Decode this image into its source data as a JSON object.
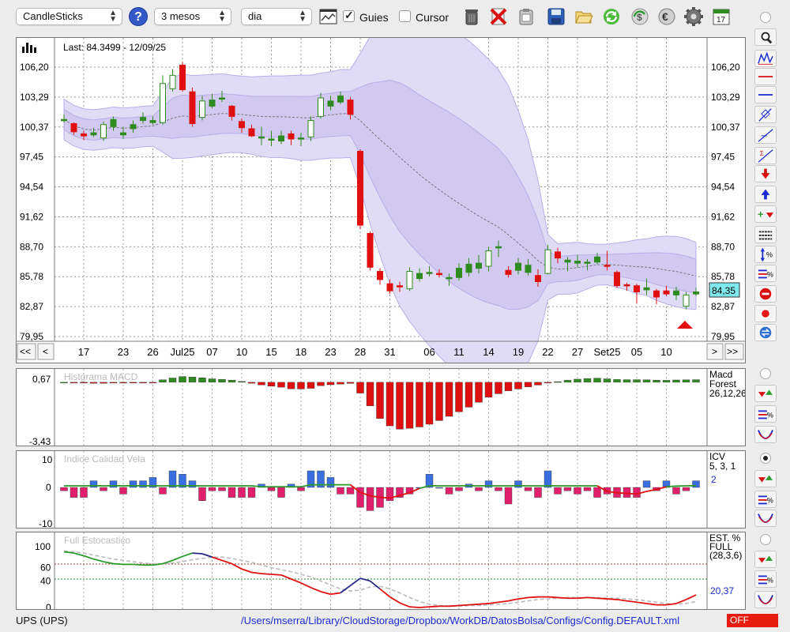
{
  "toolbar": {
    "chart_type": "CandleSticks",
    "period": "3 mesos",
    "interval": "dia",
    "help": "?",
    "guies_label": "Guies",
    "cursor_label": "Cursor",
    "guies_checked": true,
    "cursor_checked": false,
    "calendar_day": "17"
  },
  "main": {
    "last_label": "Last: 84.3499 - 12/09/25",
    "y_ticks": [
      "106,20",
      "103,29",
      "100,37",
      "97,45",
      "94,54",
      "91,62",
      "88,70",
      "85,78",
      "82,87",
      "79,95"
    ],
    "price_badge": "84,35",
    "x_labels": [
      "17",
      "23",
      "26",
      "Jul25",
      "07",
      "10",
      "15",
      "18",
      "23",
      "28",
      "31",
      "06",
      "11",
      "14",
      "19",
      "22",
      "27",
      "Set25",
      "05",
      "10"
    ],
    "nav": {
      "first": "<<",
      "prev": "<",
      "next": ">",
      "last": ">>"
    }
  },
  "macd": {
    "title": "Histgrama MACD",
    "y_top": "0,67",
    "y_bottom": "-3,43",
    "name_line1": "Macd",
    "name_line2": "Forest",
    "params": "26,12,26"
  },
  "icv": {
    "title": "Indice Calidad Vela",
    "y_top": "10",
    "y_mid": "0",
    "y_bottom": "-10",
    "name": "ICV",
    "params": "5, 3, 1",
    "value": "2"
  },
  "stoch": {
    "title": "Full Estocastico",
    "y_ticks": [
      "100",
      "60",
      "40",
      "0"
    ],
    "name_line1": "EST. %",
    "name_line2": "FULL",
    "params": "(28,3,6)",
    "value": "20,37"
  },
  "status": {
    "ticker": "UPS (UPS)",
    "path": "/Users/mserra/Library/CloudStorage/Dropbox/WorkDB/DatosBolsa/Configs/Config.DEFAULT.xml",
    "off": "OFF"
  },
  "colors": {
    "up": "#2e8b1f",
    "down": "#e01010",
    "band": "#d8d0f4",
    "macd": "#e01010",
    "icv_up": "#3a6fe0",
    "icv_down": "#e0206a"
  },
  "chart_data": {
    "type": "candlestick",
    "ylim": [
      79.95,
      106.2
    ],
    "candles": [
      [
        101.0,
        101.1,
        101.6,
        100.8
      ],
      [
        100.7,
        99.9,
        100.8,
        99.6
      ],
      [
        99.7,
        99.5,
        100.0,
        99.1
      ],
      [
        99.6,
        99.8,
        100.3,
        99.4
      ],
      [
        99.3,
        100.6,
        100.9,
        99.0
      ],
      [
        100.4,
        101.1,
        101.4,
        100.0
      ],
      [
        99.6,
        99.8,
        100.4,
        99.2
      ],
      [
        100.2,
        100.6,
        101.0,
        99.8
      ],
      [
        101.0,
        101.3,
        101.8,
        100.7
      ],
      [
        100.8,
        101.0,
        101.4,
        100.6
      ],
      [
        100.8,
        104.6,
        105.4,
        100.6
      ],
      [
        104.1,
        105.4,
        106.0,
        103.8
      ],
      [
        106.4,
        104.0,
        106.7,
        103.8
      ],
      [
        103.8,
        100.7,
        104.2,
        100.4
      ],
      [
        101.3,
        102.9,
        103.4,
        101.0
      ],
      [
        102.4,
        103.0,
        103.6,
        102.2
      ],
      [
        103.1,
        103.2,
        103.9,
        102.8
      ],
      [
        102.4,
        101.4,
        102.5,
        101.0
      ],
      [
        100.9,
        100.3,
        101.2,
        99.8
      ],
      [
        100.2,
        99.5,
        100.6,
        99.4
      ],
      [
        99.4,
        99.4,
        100.4,
        98.6
      ],
      [
        99.2,
        99.2,
        100.0,
        98.5
      ],
      [
        99.0,
        99.5,
        100.0,
        98.7
      ],
      [
        99.7,
        99.2,
        100.0,
        98.6
      ],
      [
        99.2,
        99.3,
        99.8,
        98.5
      ],
      [
        99.4,
        101.0,
        101.4,
        99.0
      ],
      [
        101.4,
        103.2,
        103.7,
        101.2
      ],
      [
        102.4,
        102.9,
        103.4,
        102.0
      ],
      [
        102.8,
        103.4,
        103.8,
        102.6
      ],
      [
        103.0,
        101.6,
        103.3,
        101.1
      ],
      [
        98.0,
        90.8,
        98.2,
        90.4
      ],
      [
        90.0,
        86.7,
        90.2,
        86.4
      ],
      [
        86.3,
        85.5,
        86.6,
        85.0
      ],
      [
        85.1,
        84.4,
        85.5,
        84.1
      ],
      [
        84.9,
        84.8,
        85.3,
        84.3
      ],
      [
        84.6,
        86.3,
        86.7,
        84.4
      ],
      [
        85.6,
        86.1,
        86.6,
        85.3
      ],
      [
        86.1,
        86.2,
        86.8,
        85.8
      ],
      [
        86.1,
        86.0,
        86.5,
        85.7
      ],
      [
        85.6,
        85.7,
        86.1,
        84.9
      ],
      [
        85.7,
        86.6,
        87.1,
        85.4
      ],
      [
        86.2,
        87.0,
        87.6,
        85.8
      ],
      [
        86.6,
        87.1,
        87.9,
        86.1
      ],
      [
        86.8,
        88.3,
        88.7,
        86.3
      ],
      [
        88.6,
        88.7,
        89.3,
        87.7
      ],
      [
        86.4,
        86.0,
        86.8,
        85.7
      ],
      [
        86.4,
        87.1,
        87.6,
        86.0
      ],
      [
        86.2,
        86.9,
        87.5,
        85.9
      ],
      [
        85.9,
        85.3,
        86.5,
        84.8
      ],
      [
        86.1,
        88.4,
        88.9,
        86.0
      ],
      [
        88.2,
        87.6,
        88.6,
        87.1
      ],
      [
        87.2,
        87.4,
        87.7,
        86.3
      ],
      [
        87.1,
        87.3,
        87.9,
        86.7
      ],
      [
        87.1,
        87.2,
        87.5,
        86.4
      ],
      [
        87.2,
        87.7,
        88.1,
        87.0
      ],
      [
        86.9,
        86.8,
        88.3,
        86.4
      ],
      [
        86.2,
        84.9,
        86.4,
        84.7
      ],
      [
        85.0,
        84.9,
        85.2,
        84.4
      ],
      [
        84.9,
        84.3,
        85.1,
        83.2
      ],
      [
        84.5,
        84.7,
        85.6,
        84.0
      ],
      [
        84.4,
        83.8,
        84.6,
        83.1
      ],
      [
        84.4,
        84.1,
        84.9,
        83.9
      ],
      [
        84.0,
        84.4,
        84.8,
        83.5
      ],
      [
        82.9,
        84.0,
        84.3,
        82.6
      ],
      [
        84.1,
        84.3,
        84.7,
        83.9
      ]
    ],
    "macd_hist": [
      0.0,
      -0.04,
      -0.05,
      -0.06,
      -0.06,
      -0.04,
      -0.05,
      -0.04,
      -0.04,
      -0.02,
      0.15,
      0.26,
      0.35,
      0.32,
      0.27,
      0.21,
      0.18,
      0.13,
      0.05,
      -0.06,
      -0.16,
      -0.24,
      -0.3,
      -0.4,
      -0.41,
      -0.37,
      -0.21,
      -0.15,
      -0.11,
      -0.07,
      -0.66,
      -1.44,
      -2.21,
      -2.66,
      -2.86,
      -2.81,
      -2.73,
      -2.56,
      -2.34,
      -2.08,
      -1.8,
      -1.52,
      -1.22,
      -0.91,
      -0.7,
      -0.52,
      -0.41,
      -0.28,
      -0.17,
      -0.05,
      0.04,
      0.12,
      0.19,
      0.23,
      0.25,
      0.21,
      0.17,
      0.16,
      0.16,
      0.15,
      0.13,
      0.12,
      0.14,
      0.15,
      0.16
    ],
    "icv_hist": [
      -1,
      -3,
      -3,
      2,
      -1,
      2,
      -2,
      2,
      2,
      3,
      -2,
      5,
      4,
      2,
      -4,
      -1,
      -1,
      -3,
      -3,
      -3,
      1,
      -1,
      -3,
      1,
      -1,
      5,
      5,
      3,
      -2,
      -2,
      -6,
      -7,
      -6,
      -4,
      -3,
      -2,
      0,
      4,
      0,
      -2,
      -1,
      1,
      -1,
      2,
      -1,
      -5,
      2,
      -1,
      -3,
      5,
      -2,
      -1,
      -2,
      -1,
      -3,
      -2,
      -3,
      -3,
      -3,
      2,
      -1,
      2,
      -2,
      -1,
      2
    ],
    "icv_line": [
      0.5,
      0.5,
      0.5,
      0.5,
      0.5,
      0.5,
      0.5,
      0.5,
      0.5,
      0.5,
      0.5,
      0.5,
      0.5,
      0.5,
      0.5,
      0.5,
      0.5,
      0.5,
      0.5,
      0.5,
      0.2,
      0.2,
      0.2,
      0.2,
      0.2,
      0.8,
      0.8,
      0.8,
      0.8,
      0.8,
      -1.5,
      -2.5,
      -3,
      -3.2,
      -2.4,
      -1.6,
      -0.3,
      0.5,
      0.5,
      0.5,
      0.5,
      0.5,
      0.5,
      0.5,
      0.5,
      0.5,
      0.5,
      0.5,
      0.5,
      0.5,
      0.5,
      0.5,
      0.5,
      0.5,
      0.5,
      -1.2,
      -1.6,
      -1.8,
      -2.0,
      -1.2,
      -0.6,
      0.2,
      0.4,
      0.5,
      0.5
    ],
    "stoch_k": [
      84,
      82,
      78,
      73,
      69,
      66,
      65,
      65,
      64,
      64,
      66,
      71,
      77,
      82,
      81,
      76,
      71,
      66,
      58,
      53,
      51,
      50,
      49,
      43,
      37,
      30,
      24,
      20,
      22,
      33,
      44,
      40,
      28,
      16,
      7,
      1,
      0,
      1,
      2,
      2,
      3,
      4,
      5,
      6,
      8,
      10,
      13,
      15,
      16,
      16,
      15,
      14,
      14,
      15,
      14,
      13,
      12,
      10,
      8,
      6,
      4,
      4,
      6,
      12,
      19
    ],
    "stoch_d": [
      85,
      84,
      82,
      79,
      76,
      73,
      71,
      69,
      67,
      66,
      66,
      67,
      69,
      72,
      74,
      76,
      76,
      74,
      71,
      68,
      64,
      60,
      57,
      54,
      50,
      46,
      40,
      34,
      28,
      25,
      26,
      31,
      32,
      28,
      22,
      15,
      9,
      5,
      3,
      2,
      2,
      3,
      3,
      4,
      5,
      6,
      8,
      10,
      12,
      13,
      14,
      15,
      15,
      15,
      15,
      14,
      14,
      13,
      12,
      10,
      8,
      6,
      5,
      6,
      9
    ]
  }
}
